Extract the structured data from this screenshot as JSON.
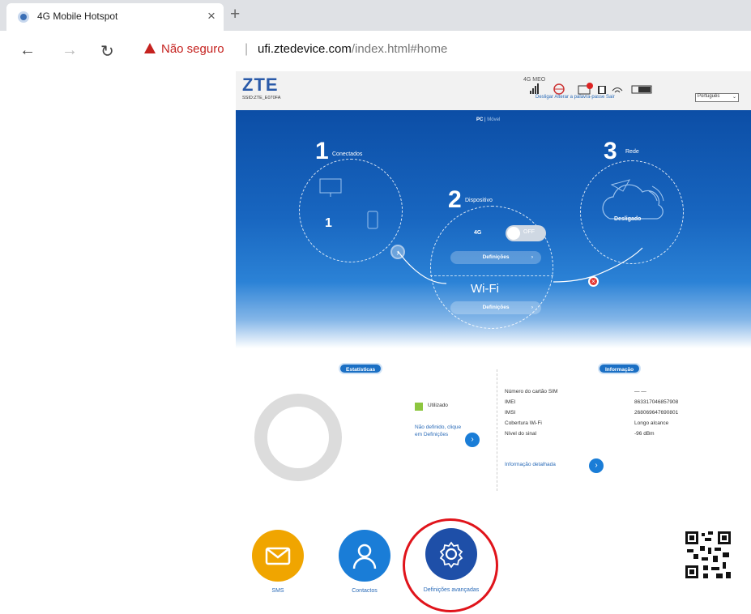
{
  "browser": {
    "tab_title": "4G Mobile Hotspot",
    "tab_close": "×",
    "new_tab": "+",
    "back": "←",
    "forward": "→",
    "reload": "↻",
    "security_label": "Não seguro",
    "separator": "|",
    "url_host": "ufi.ztedevice.com",
    "url_path": "/index.html#home"
  },
  "header": {
    "logo": "ZTE",
    "ssid": "SSID:ZTE_E070FA",
    "status_text": "4G  MEO",
    "links": "Desligar   Alterar a palavra-passe   Sair",
    "language": "Português"
  },
  "banner": {
    "view_pc": "PC",
    "view_mobile": "Móvel",
    "step1": {
      "num": "1",
      "label": "Conectados",
      "count": "1"
    },
    "step2": {
      "num": "2",
      "label": "Dispositivo",
      "network_label": "4G",
      "toggle_label": "OFF",
      "settings_label": "Definições",
      "wifi_label": "Wi-Fi",
      "wifi_settings_label": "Definições"
    },
    "step3": {
      "num": "3",
      "label": "Rede",
      "status": "Desligado"
    }
  },
  "stats": {
    "badge": "Estatísticas",
    "legend_used": "Utilizado",
    "limit_text": "Não definido, clique em Definições"
  },
  "info": {
    "badge": "Informação",
    "rows": [
      {
        "label": "Número do cartão SIM",
        "value": "— —"
      },
      {
        "label": "IMEI",
        "value": "863317046857908"
      },
      {
        "label": "IMSI",
        "value": "268069647690801"
      },
      {
        "label": "Cobertura Wi-Fi",
        "value": "Longo alcance"
      },
      {
        "label": "Nível do sinal",
        "value": "-96 dBm"
      }
    ],
    "detail_link": "Informação detalhada"
  },
  "actions": {
    "sms_label": "SMS",
    "contacts_label": "Contactos",
    "settings_label": "Definições avançadas"
  },
  "colors": {
    "sms": "#f0a500",
    "contacts": "#1a7dd7",
    "settings": "#1e4fa8",
    "highlight": "#e0141b"
  }
}
